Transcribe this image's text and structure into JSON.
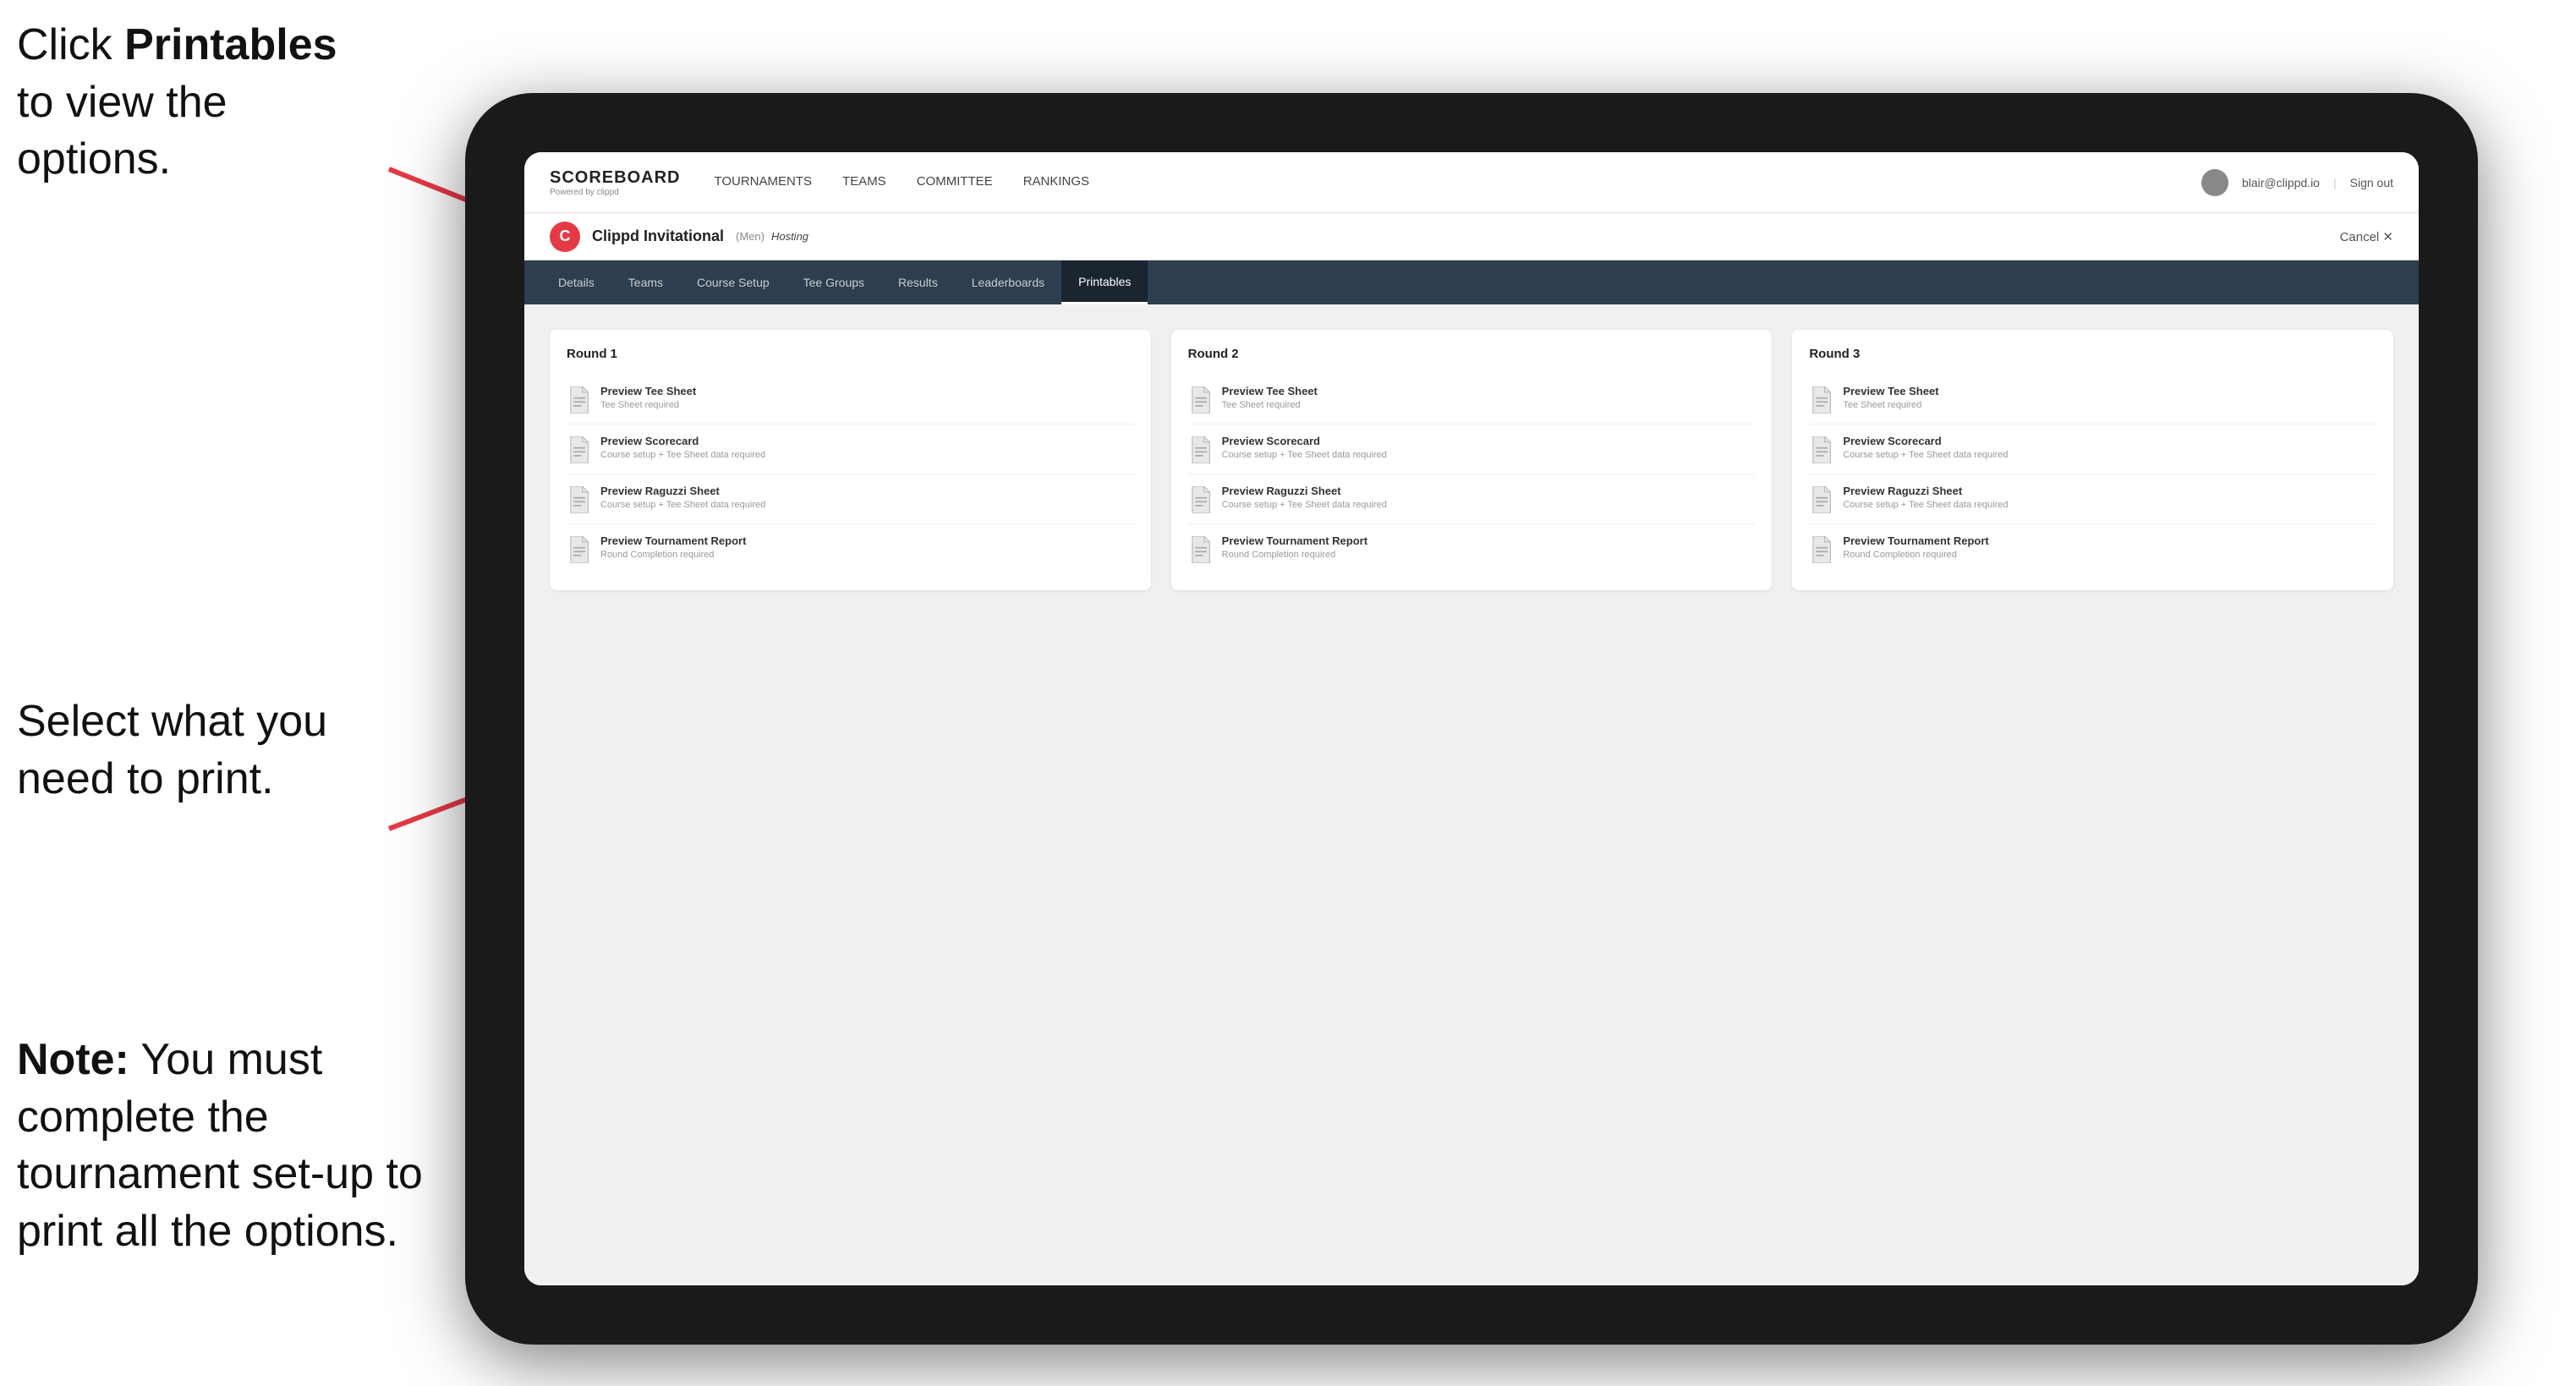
{
  "annotations": {
    "top_text_1": "Click ",
    "top_bold": "Printables",
    "top_text_2": " to view the options.",
    "middle": "Select what you need to print.",
    "note_bold": "Note:",
    "note_text": " You must complete the tournament set-up to print all the options."
  },
  "nav": {
    "logo_title": "SCOREBOARD",
    "logo_sub": "Powered by clippd",
    "links": [
      "TOURNAMENTS",
      "TEAMS",
      "COMMITTEE",
      "RANKINGS"
    ],
    "user_email": "blair@clippd.io",
    "sign_out": "Sign out"
  },
  "tournament": {
    "logo_letter": "C",
    "name": "Clippd Invitational",
    "badge": "(Men)",
    "hosting": "Hosting",
    "cancel": "Cancel ✕"
  },
  "sub_tabs": [
    "Details",
    "Teams",
    "Course Setup",
    "Tee Groups",
    "Results",
    "Leaderboards",
    "Printables"
  ],
  "active_sub_tab": "Printables",
  "rounds": [
    {
      "title": "Round 1",
      "items": [
        {
          "label": "Preview Tee Sheet",
          "sublabel": "Tee Sheet required"
        },
        {
          "label": "Preview Scorecard",
          "sublabel": "Course setup + Tee Sheet data required"
        },
        {
          "label": "Preview Raguzzi Sheet",
          "sublabel": "Course setup + Tee Sheet data required"
        },
        {
          "label": "Preview Tournament Report",
          "sublabel": "Round Completion required"
        }
      ]
    },
    {
      "title": "Round 2",
      "items": [
        {
          "label": "Preview Tee Sheet",
          "sublabel": "Tee Sheet required"
        },
        {
          "label": "Preview Scorecard",
          "sublabel": "Course setup + Tee Sheet data required"
        },
        {
          "label": "Preview Raguzzi Sheet",
          "sublabel": "Course setup + Tee Sheet data required"
        },
        {
          "label": "Preview Tournament Report",
          "sublabel": "Round Completion required"
        }
      ]
    },
    {
      "title": "Round 3",
      "items": [
        {
          "label": "Preview Tee Sheet",
          "sublabel": "Tee Sheet required"
        },
        {
          "label": "Preview Scorecard",
          "sublabel": "Course setup + Tee Sheet data required"
        },
        {
          "label": "Preview Raguzzi Sheet",
          "sublabel": "Course setup + Tee Sheet data required"
        },
        {
          "label": "Preview Tournament Report",
          "sublabel": "Round Completion required"
        }
      ]
    }
  ]
}
